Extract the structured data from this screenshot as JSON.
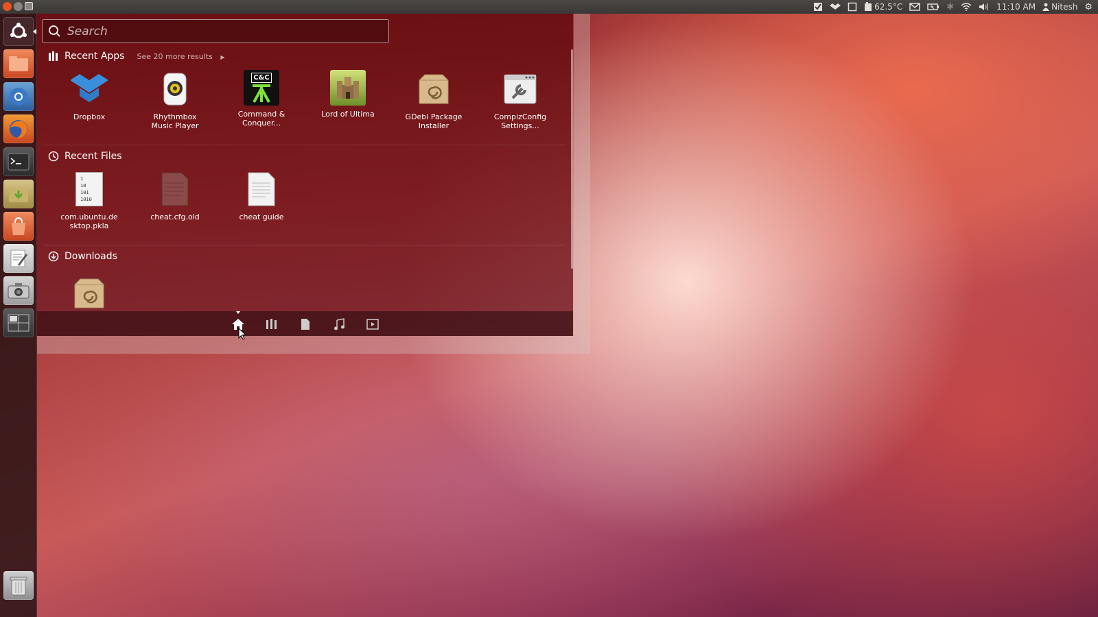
{
  "top_panel": {
    "temperature": "62.5°C",
    "time": "11:10 AM",
    "user": "Nitesh"
  },
  "search": {
    "placeholder": "Search"
  },
  "recent_apps": {
    "title": "Recent Apps",
    "see_more": "See 20 more results",
    "items": [
      {
        "line1": "Dropbox",
        "line2": "",
        "icon": "dropbox-icon"
      },
      {
        "line1": "Rhythmbox",
        "line2": "Music Player",
        "icon": "rhythmbox-icon"
      },
      {
        "line1": "Command &",
        "line2": "Conquer...",
        "icon": "command-conquer-icon"
      },
      {
        "line1": "Lord of Ultima",
        "line2": "",
        "icon": "lord-of-ultima-icon"
      },
      {
        "line1": "GDebi Package",
        "line2": "Installer",
        "icon": "gdebi-icon"
      },
      {
        "line1": "CompizConfig",
        "line2": "Settings...",
        "icon": "compizconfig-icon"
      }
    ]
  },
  "recent_files": {
    "title": "Recent Files",
    "items": [
      {
        "line1": "com.ubuntu.de",
        "line2": "sktop.pkla",
        "icon": "binary-file-icon"
      },
      {
        "line1": "cheat.cfg.old",
        "line2": "",
        "icon": "config-file-icon"
      },
      {
        "line1": "cheat guide",
        "line2": "",
        "icon": "text-file-icon"
      }
    ]
  },
  "downloads": {
    "title": "Downloads",
    "items": [
      {
        "line1": "",
        "line2": "",
        "icon": "debian-package-icon"
      }
    ]
  },
  "binary_lines": [
    "1",
    "10",
    "101",
    "1010"
  ],
  "command_conquer_text": "C&C",
  "lenses": [
    "home-lens",
    "applications-lens",
    "files-lens",
    "music-lens",
    "video-lens"
  ],
  "colors": {
    "dash_bg": "#6e0f14",
    "top_panel": "#3c3b37",
    "accent": "#dd4814"
  }
}
